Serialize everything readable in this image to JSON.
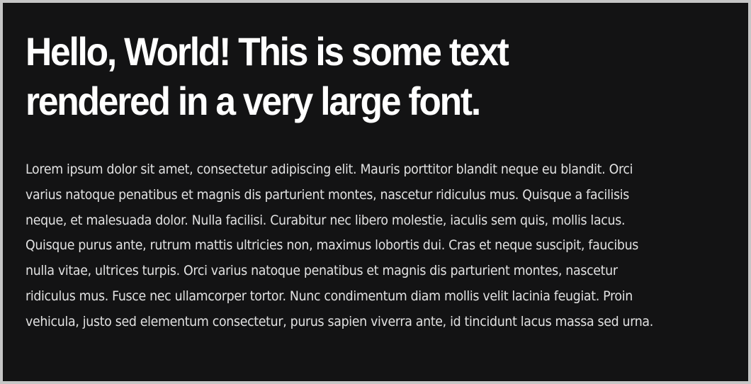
{
  "content": {
    "heading": "Hello, World! This is some text rendered in a very large font.",
    "paragraph": "Lorem ipsum dolor sit amet, consectetur adipiscing elit. Mauris porttitor blandit neque eu blandit. Orci varius natoque penatibus et magnis dis parturient montes, nascetur ridiculus mus. Quisque a facilisis neque, et malesuada dolor. Nulla facilisi. Curabitur nec libero molestie, iaculis sem quis, mollis lacus. Quisque purus ante, rutrum mattis ultricies non, maximus lobortis dui. Cras et neque suscipit, faucibus nulla vitae, ultrices turpis. Orci varius natoque penatibus et magnis dis parturient montes, nascetur ridiculus mus. Fusce nec ullamcorper tortor. Nunc condimentum diam mollis velit lacinia feugiat. Proin vehicula, justo sed elementum consectetur, purus sapien viverra ante, id tincidunt lacus massa sed urna."
  },
  "colors": {
    "frame": "#c6c6c6",
    "background": "#131314",
    "heading_text": "#ffffff",
    "body_text": "#e2e2e2"
  }
}
